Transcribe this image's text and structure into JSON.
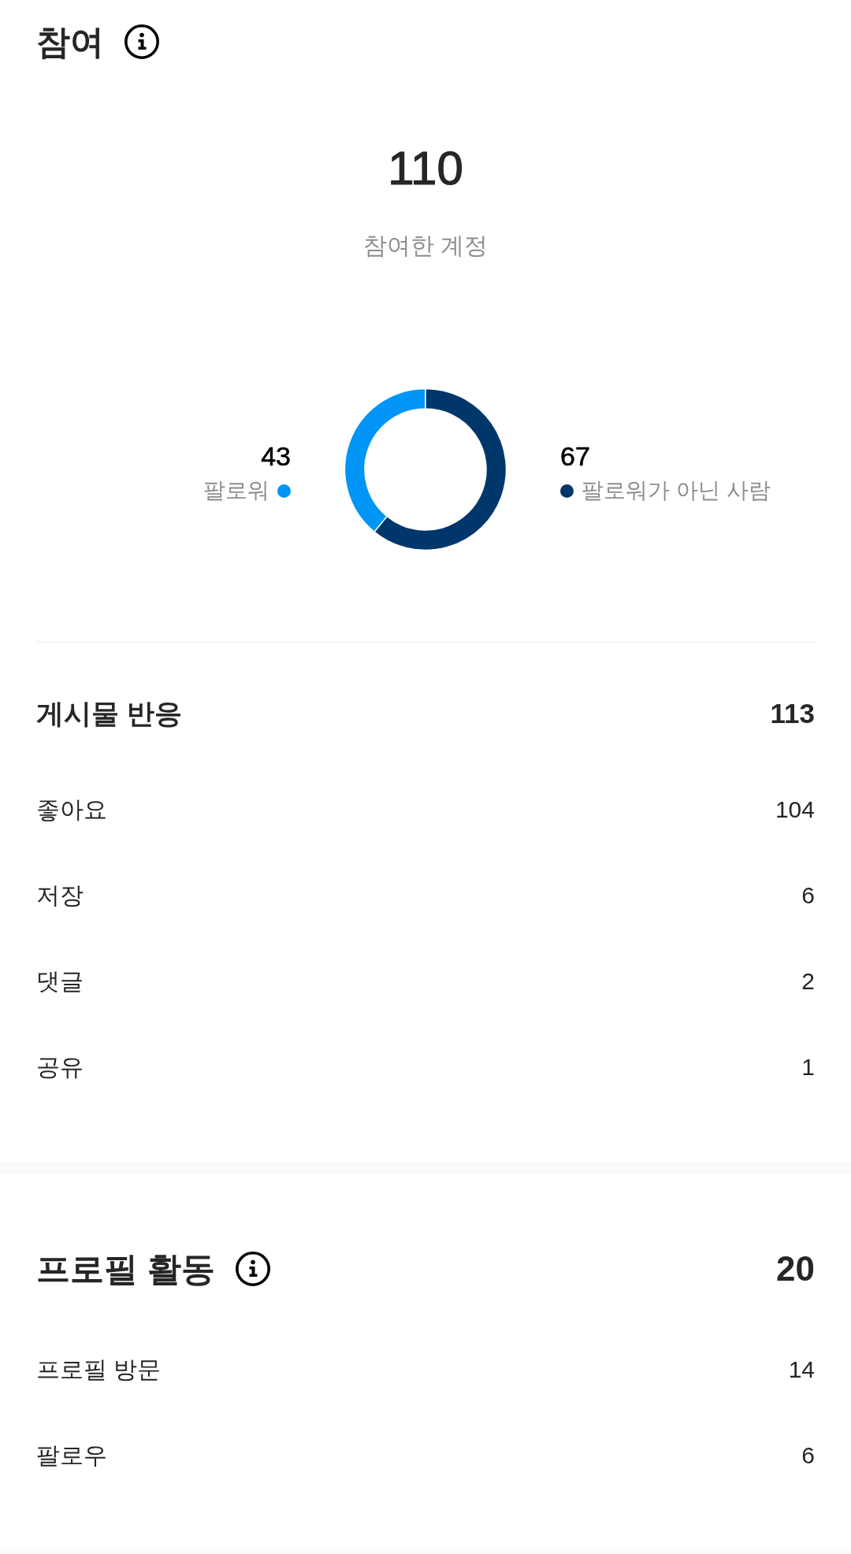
{
  "engagement": {
    "title": "참여",
    "total": {
      "value": "110",
      "label": "참여한 계정"
    },
    "breakdown": {
      "chart_data": {
        "type": "donut",
        "categories": [
          "팔로워",
          "팔로워가 아닌 사람"
        ],
        "values": [
          43,
          67
        ],
        "data_labels": true
      },
      "slices": [
        {
          "color": "#0095f6"
        },
        {
          "color": "#00376b"
        }
      ]
    }
  },
  "post_interactions": {
    "title": "게시물 반응",
    "total": "113",
    "rows": [
      {
        "label": "좋아요",
        "value": "104"
      },
      {
        "label": "저장",
        "value": "6"
      },
      {
        "label": "댓글",
        "value": "2"
      },
      {
        "label": "공유",
        "value": "1"
      }
    ]
  },
  "profile_activity": {
    "title": "프로필 활동",
    "total": "20",
    "rows": [
      {
        "label": "프로필 방문",
        "value": "14"
      },
      {
        "label": "팔로우",
        "value": "6"
      }
    ]
  }
}
